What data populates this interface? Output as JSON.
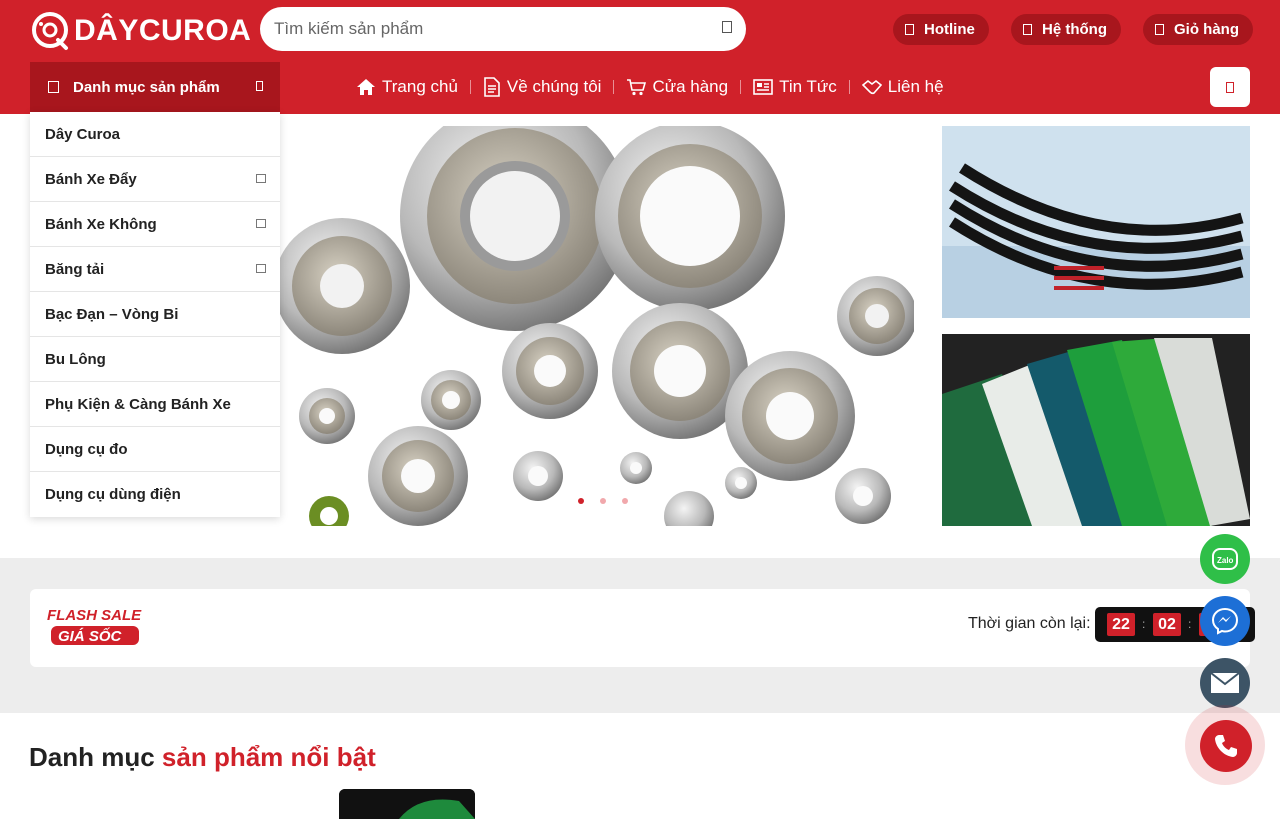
{
  "header": {
    "logo_text": "DÂYCUROA",
    "search_placeholder": "Tìm kiếm sản phẩm",
    "hotline_label": "Hotline",
    "system_label": "Hệ thống",
    "cart_label": "Giỏ hàng"
  },
  "nav": {
    "category_title": "Danh mục sản phẩm",
    "items": [
      {
        "label": "Trang chủ",
        "icon": "home-icon"
      },
      {
        "label": "Về chúng tôi",
        "icon": "document-icon"
      },
      {
        "label": "Cửa hàng",
        "icon": "shopping-cart-icon"
      },
      {
        "label": "Tin Tức",
        "icon": "newspaper-icon"
      },
      {
        "label": "Liên hệ",
        "icon": "handshake-icon"
      }
    ]
  },
  "categories": [
    {
      "label": "Dây Curoa",
      "expandable": false
    },
    {
      "label": "Bánh Xe Đẩy",
      "expandable": true
    },
    {
      "label": "Bánh Xe Không",
      "expandable": true
    },
    {
      "label": "Băng tải",
      "expandable": true
    },
    {
      "label": "Bạc Đạn – Vòng Bi",
      "expandable": false
    },
    {
      "label": "Bu Lông",
      "expandable": false
    },
    {
      "label": "Phụ Kiện & Càng Bánh Xe",
      "expandable": false
    },
    {
      "label": "Dụng cụ đo",
      "expandable": false
    },
    {
      "label": "Dụng cụ dùng điện",
      "expandable": false
    }
  ],
  "slider": {
    "dots": 3,
    "active_dot": 1
  },
  "flash_sale": {
    "logo_line1": "FLASH SALE",
    "logo_line2": "GIÁ SỐC",
    "timer_label": "Thời gian còn lại:",
    "hours": "22",
    "minutes": "02"
  },
  "section": {
    "title_plain": "Danh mục",
    "title_accent": "sản phẩm nổi bật"
  },
  "floating": {
    "zalo_label": "Zalo"
  },
  "colors": {
    "brand_red": "#d0212a",
    "dark_red": "#a8161d",
    "zalo_green": "#2fbf48",
    "messenger_blue": "#1d6fd6",
    "mail_slate": "#3d5466"
  }
}
